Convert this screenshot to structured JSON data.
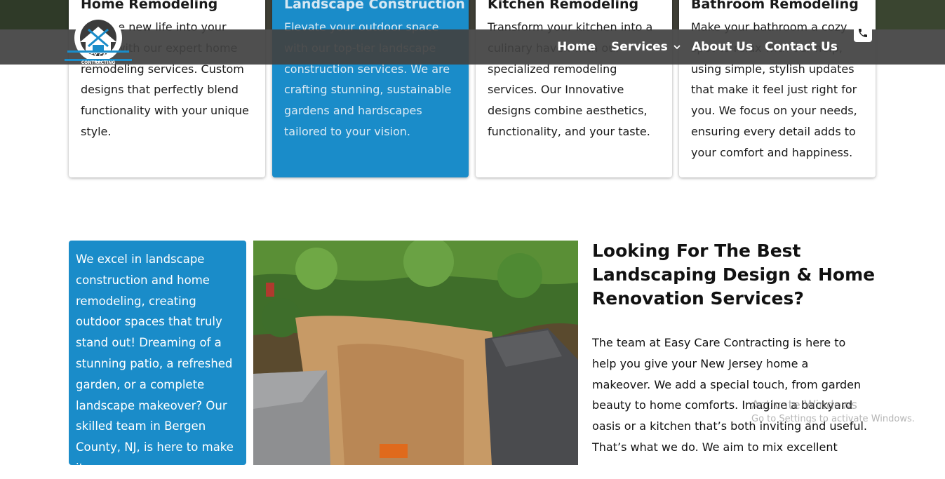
{
  "header": {
    "logo_text": [
      "EASY CARE",
      "CONTRACTING"
    ],
    "nav": [
      {
        "label": "Home"
      },
      {
        "label": "Services",
        "icon": "chevron-down-icon"
      },
      {
        "label": "About Us"
      },
      {
        "label": "Contact Us"
      }
    ],
    "phone_icon": "phone-icon"
  },
  "cards": [
    {
      "title": "Home Remodeling",
      "desc": "Breathe new life into your home with our expert home remodeling services. Custom designs that perfectly blend functionality with your unique style.",
      "active": false
    },
    {
      "title": "Landscape Construction",
      "desc": "Elevate your outdoor space with our top-tier landscape construction services. We are crafting stunning, sustainable gardens and hardscapes tailored to your vision.",
      "active": true
    },
    {
      "title": "Kitchen Remodeling",
      "desc": "Transform your kitchen into a culinary haven with our specialized remodeling services. Our Innovative designs combine aesthetics, functionality, and your taste.",
      "active": false
    },
    {
      "title": "Bathroom Remodeling",
      "desc": "Make your bathroom a cozy spot to relax with our help, using simple, stylish updates that make it feel just right for you. We focus on your needs, ensuring every detail adds to your comfort and happiness.",
      "active": false
    }
  ],
  "intro_box": {
    "text": "We excel in landscape construction and home remodeling, creating outdoor spaces that truly stand out! Dreaming of a stunning patio, a refreshed garden, or a complete landscape makeover? Our skilled team in Bergen County, NJ, is here to make it"
  },
  "section": {
    "heading": "Looking For The Best Landscaping Design & Home Renovation Services?",
    "body": "The team at Easy Care Contracting is here to help you give your New Jersey home a makeover. We add a special touch, from garden beauty to home comforts. Imagine a backyard oasis or a kitchen that’s both inviting and useful. That’s what we do. We aim to mix excellent"
  },
  "watermark": {
    "line1": "Activate Windows",
    "line2": "Go to Settings to activate Windows."
  },
  "colors": {
    "accent_blue": "#1a8cc9",
    "header_bg": "#424242",
    "text_dark": "#111111"
  }
}
